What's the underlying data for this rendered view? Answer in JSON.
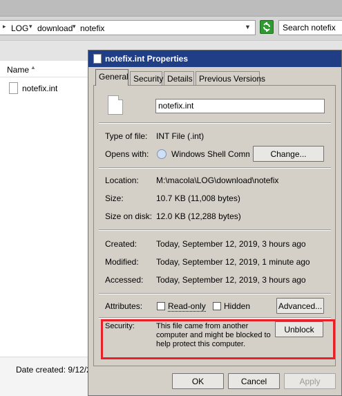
{
  "explorer": {
    "breadcrumb": [
      "LOG",
      "download",
      "notefix"
    ],
    "search_placeholder": "Search notefix",
    "column_name": "Name",
    "files": [
      {
        "name": "notefix.int"
      }
    ],
    "details_date_created": "Date created: 9/12/2"
  },
  "dialog": {
    "title": "notefix.int Properties",
    "tabs": [
      {
        "label": "General",
        "active": true
      },
      {
        "label": "Security",
        "active": false
      },
      {
        "label": "Details",
        "active": false
      },
      {
        "label": "Previous Versions",
        "active": false
      }
    ],
    "file_name_value": "notefix.int",
    "type_of_file": {
      "label": "Type of file:",
      "value": "INT File (.int)"
    },
    "opens_with": {
      "label": "Opens with:",
      "value": "Windows Shell Commor",
      "button": "Change..."
    },
    "location": {
      "label": "Location:",
      "value": "M:\\macola\\LOG\\download\\notefix"
    },
    "size": {
      "label": "Size:",
      "value": "10.7 KB (11,008 bytes)"
    },
    "size_on_disk": {
      "label": "Size on disk:",
      "value": "12.0 KB (12,288 bytes)"
    },
    "created": {
      "label": "Created:",
      "value": "Today, September 12, 2019, 3 hours ago"
    },
    "modified": {
      "label": "Modified:",
      "value": "Today, September 12, 2019, 1 minute ago"
    },
    "accessed": {
      "label": "Accessed:",
      "value": "Today, September 12, 2019, 3 hours ago"
    },
    "attributes": {
      "label": "Attributes:",
      "read_only": "Read-only",
      "hidden": "Hidden",
      "advanced_button": "Advanced..."
    },
    "security": {
      "label": "Security:",
      "line1": "This file came from another",
      "line2": "computer and might be blocked to",
      "line3": "help protect this computer.",
      "unblock_button": "Unblock"
    },
    "buttons": {
      "ok": "OK",
      "cancel": "Cancel",
      "apply": "Apply"
    }
  },
  "colors": {
    "title_bar": "#1f3e86",
    "dialog_face": "#d4d0c8",
    "highlight_box": "#e8202a"
  }
}
